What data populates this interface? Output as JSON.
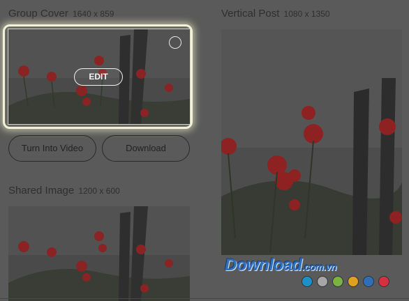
{
  "sections": {
    "group_cover": {
      "title": "Group Cover",
      "dimensions": "1640 x 859",
      "edit_label": "EDIT"
    },
    "vertical_post": {
      "title": "Vertical Post",
      "dimensions": "1080 x 1350"
    },
    "shared_image": {
      "title": "Shared Image",
      "dimensions": "1200 x 600"
    }
  },
  "buttons": {
    "turn_into_video": "Turn Into Video",
    "download": "Download"
  },
  "watermark": {
    "main": "Download",
    "tld": ".com.vn"
  },
  "palette": [
    "#1e90c8",
    "#a6a6a6",
    "#7cb242",
    "#e0a020",
    "#2f6fb8",
    "#d63040"
  ],
  "icons": [
    "selection-circle-icon"
  ]
}
